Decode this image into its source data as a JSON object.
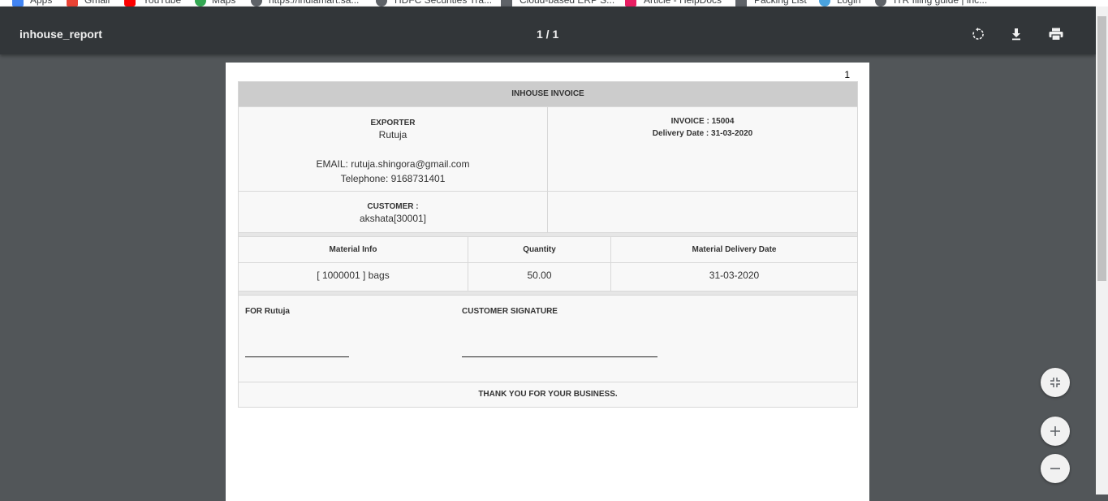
{
  "bookmarks": [
    "Apps",
    "Gmail",
    "YouTube",
    "Maps",
    "https://indiamart.sa...",
    "HDFC Securities Tra...",
    "Cloud-based ERP S...",
    "Article - HelpDocs",
    "Packing List",
    "Login",
    "ITR filing guide | inc..."
  ],
  "toolbar": {
    "title": "inhouse_report",
    "page_indicator": "1 / 1",
    "rotate_icon": "rotate-icon",
    "download_icon": "download-icon",
    "print_icon": "print-icon"
  },
  "page": {
    "number": "1",
    "invoice": {
      "heading": "INHOUSE INVOICE",
      "exporter_label": "EXPORTER",
      "exporter_name": "Rutuja",
      "email": "EMAIL: rutuja.shingora@gmail.com",
      "telephone": "Telephone: 9168731401",
      "invoice_no": "INVOICE : 15004",
      "delivery_date": "Delivery Date : 31-03-2020",
      "customer_label": "CUSTOMER :",
      "customer_name": "akshata[30001]",
      "table": {
        "headers": [
          "Material Info",
          "Quantity",
          "Material Delivery Date"
        ],
        "rows": [
          [
            "[ 1000001 ] bags",
            "50.00",
            "31-03-2020"
          ]
        ]
      },
      "for_label": "FOR Rutuja",
      "customer_signature_label": "CUSTOMER SIGNATURE",
      "footer": "THANK YOU FOR YOUR BUSINESS."
    }
  },
  "zoom": {
    "fit_icon": "fit-to-page-icon",
    "zoom_in_icon": "plus-icon",
    "zoom_out_icon": "minus-icon"
  },
  "colors": {
    "toolbar_bg": "#323639",
    "viewer_bg": "#525659",
    "header_gray": "#cccccc"
  }
}
